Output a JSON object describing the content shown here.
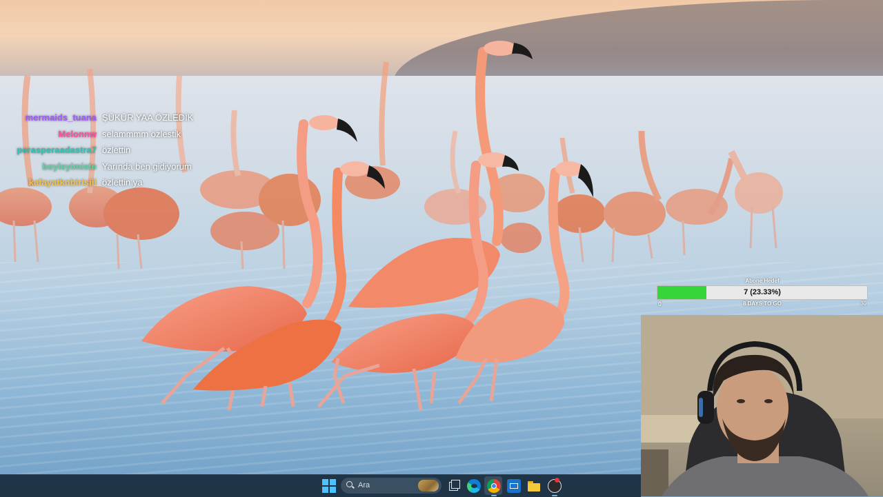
{
  "wallpaper": {
    "description_icon": "flamingos-wallpaper"
  },
  "chat": {
    "messages": [
      {
        "user": "mermaids_tuana",
        "text": "ŞÜKÜR YAA ÖZLEDİK",
        "color": "#a259ff"
      },
      {
        "user": "Melonnw",
        "text": "selammmm özlestik",
        "color": "#ff4fa3"
      },
      {
        "user": "perasperaadastra7",
        "text": "özlettin",
        "color": "#2ec4b6"
      },
      {
        "user": "boyleyimiste",
        "text": "Yarında ben gidiyorum",
        "color": "#5fd3a2"
      },
      {
        "user": "kafayatknbirisiii",
        "text": "özlettin ya",
        "color": "#f2c14e"
      }
    ]
  },
  "goal": {
    "title": "Abone Hedef",
    "value_text": "7 (23.33%)",
    "progress": 0.2333,
    "min": "0",
    "max": "30",
    "days_left": "8 DAYS TO GO",
    "fill_color": "#35d63a"
  },
  "webcam": {
    "label_icon": "webcam-feed"
  },
  "taskbar": {
    "search_placeholder": "Ara",
    "icons": [
      "windows-start-icon",
      "search-icon",
      "task-view-icon",
      "edge-icon",
      "chrome-icon",
      "mail-icon",
      "file-explorer-icon",
      "obs-icon"
    ],
    "background": "#1f3447"
  }
}
